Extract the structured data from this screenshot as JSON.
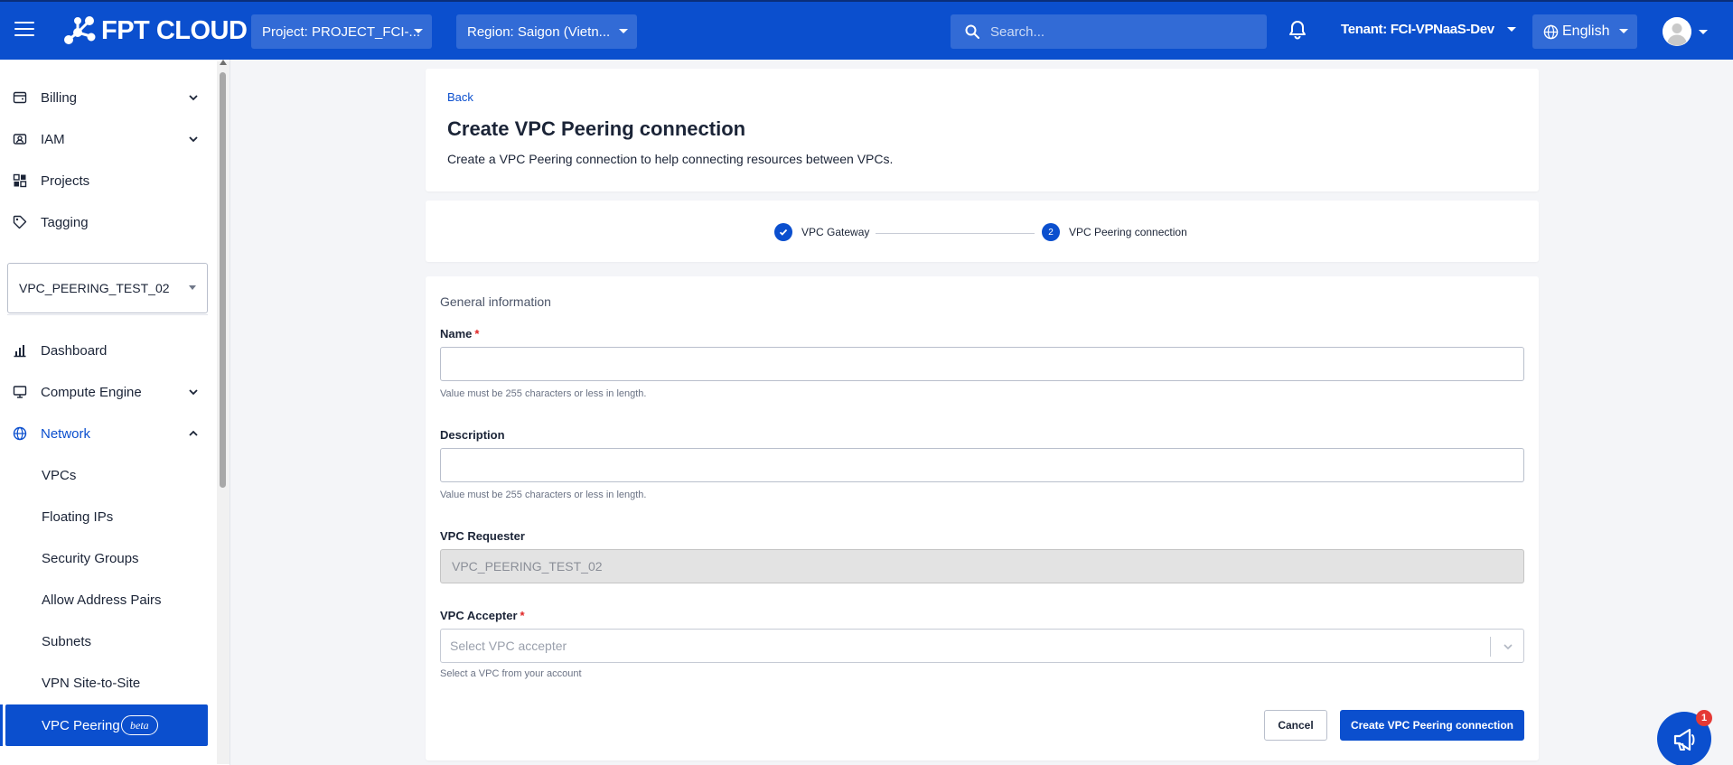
{
  "header": {
    "brand": "FPT CLOUD",
    "project_label": "Project: PROJECT_FCI-...",
    "region_label": "Region: Saigon (Vietn...",
    "search_placeholder": "Search...",
    "tenant_label": "Tenant: FCI-VPNaaS-Dev",
    "language": "English"
  },
  "sidebar": {
    "top_items": [
      {
        "label": "Billing",
        "icon": "wallet-icon",
        "expandable": true
      },
      {
        "label": "IAM",
        "icon": "id-card-icon",
        "expandable": true
      },
      {
        "label": "Projects",
        "icon": "projects-icon",
        "expandable": false
      },
      {
        "label": "Tagging",
        "icon": "tag-icon",
        "expandable": false
      }
    ],
    "vpc_selector": "VPC_PEERING_TEST_02",
    "items": [
      {
        "label": "Dashboard",
        "icon": "bar-chart-icon"
      },
      {
        "label": "Compute Engine",
        "icon": "monitor-icon"
      },
      {
        "label": "Network",
        "icon": "globe-icon"
      }
    ],
    "network_children": [
      "VPCs",
      "Floating IPs",
      "Security Groups",
      "Allow Address Pairs",
      "Subnets",
      "VPN Site-to-Site",
      "VPC Peering"
    ],
    "active_badge": "beta"
  },
  "page": {
    "back_label": "Back",
    "title": "Create VPC Peering connection",
    "description": "Create a VPC Peering connection to help connecting resources between VPCs."
  },
  "steps": [
    {
      "number": "1",
      "label": "VPC Gateway",
      "state": "done"
    },
    {
      "number": "2",
      "label": "VPC Peering connection",
      "state": "current"
    }
  ],
  "form": {
    "section_title": "General information",
    "name": {
      "label": "Name",
      "required": "*",
      "value": "",
      "hint": "Value must be 255 characters or less in length."
    },
    "description": {
      "label": "Description",
      "value": "",
      "hint": "Value must be 255 characters or less in length."
    },
    "vpc_requester": {
      "label": "VPC Requester",
      "value": "VPC_PEERING_TEST_02"
    },
    "vpc_accepter": {
      "label": "VPC Accepter",
      "required": "*",
      "placeholder": "Select VPC accepter",
      "hint": "Select a VPC from your account"
    },
    "cancel_label": "Cancel",
    "submit_label": "Create VPC Peering connection"
  },
  "notifications": {
    "badge_count": "1"
  },
  "colors": {
    "primary": "#0b4fce",
    "required": "#e02424",
    "badge": "#e53935"
  }
}
